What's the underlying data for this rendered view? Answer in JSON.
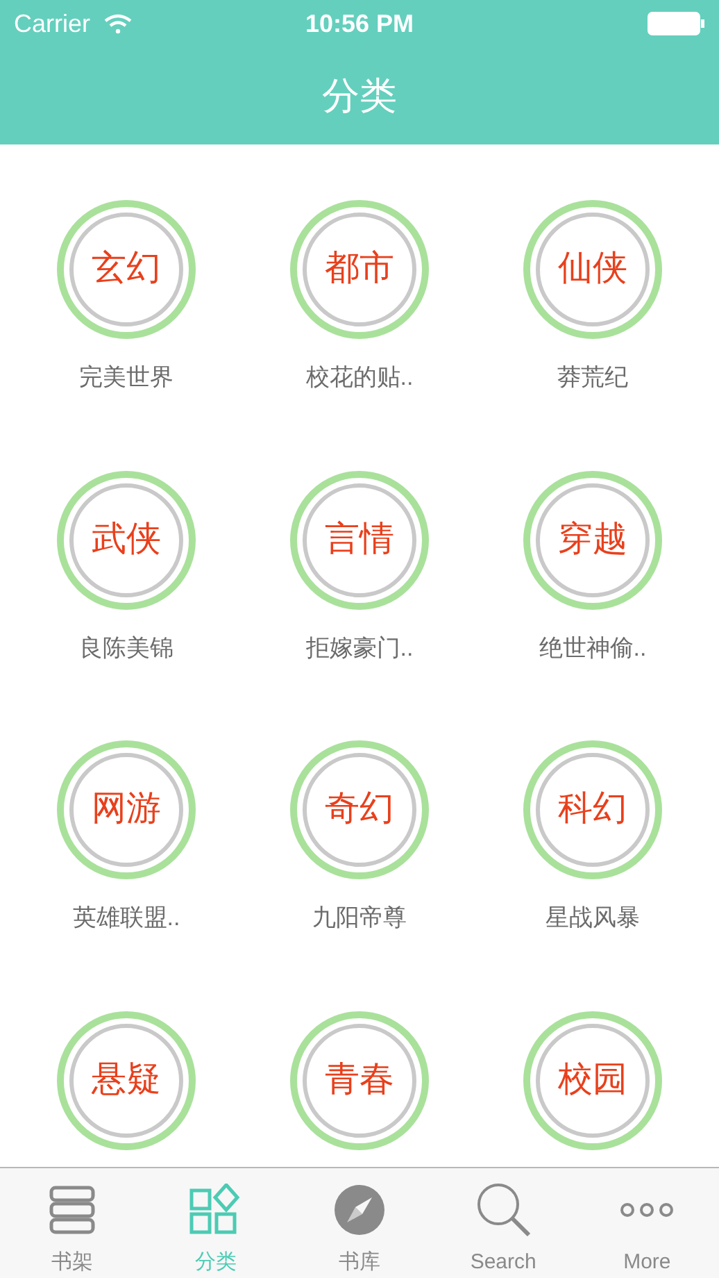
{
  "status_bar": {
    "carrier": "Carrier",
    "time": "10:56 PM"
  },
  "nav_bar": {
    "title": "分类"
  },
  "categories": [
    {
      "name": "玄幻",
      "book": "完美世界"
    },
    {
      "name": "都市",
      "book": "校花的贴.."
    },
    {
      "name": "仙侠",
      "book": "莽荒纪"
    },
    {
      "name": "武侠",
      "book": "良陈美锦"
    },
    {
      "name": "言情",
      "book": "拒嫁豪门.."
    },
    {
      "name": "穿越",
      "book": "绝世神偷.."
    },
    {
      "name": "网游",
      "book": "英雄联盟.."
    },
    {
      "name": "奇幻",
      "book": "九阳帝尊"
    },
    {
      "name": "科幻",
      "book": "星战风暴"
    },
    {
      "name": "悬疑"
    },
    {
      "name": "青春"
    },
    {
      "name": "校园"
    }
  ],
  "tab_bar": [
    {
      "label": "书架",
      "kind": "shelf",
      "selected": false
    },
    {
      "label": "分类",
      "kind": "grid",
      "selected": true
    },
    {
      "label": "书库",
      "kind": "compass",
      "selected": false
    },
    {
      "label": "Search",
      "kind": "search",
      "selected": false
    },
    {
      "label": "More",
      "kind": "more",
      "selected": false
    }
  ]
}
